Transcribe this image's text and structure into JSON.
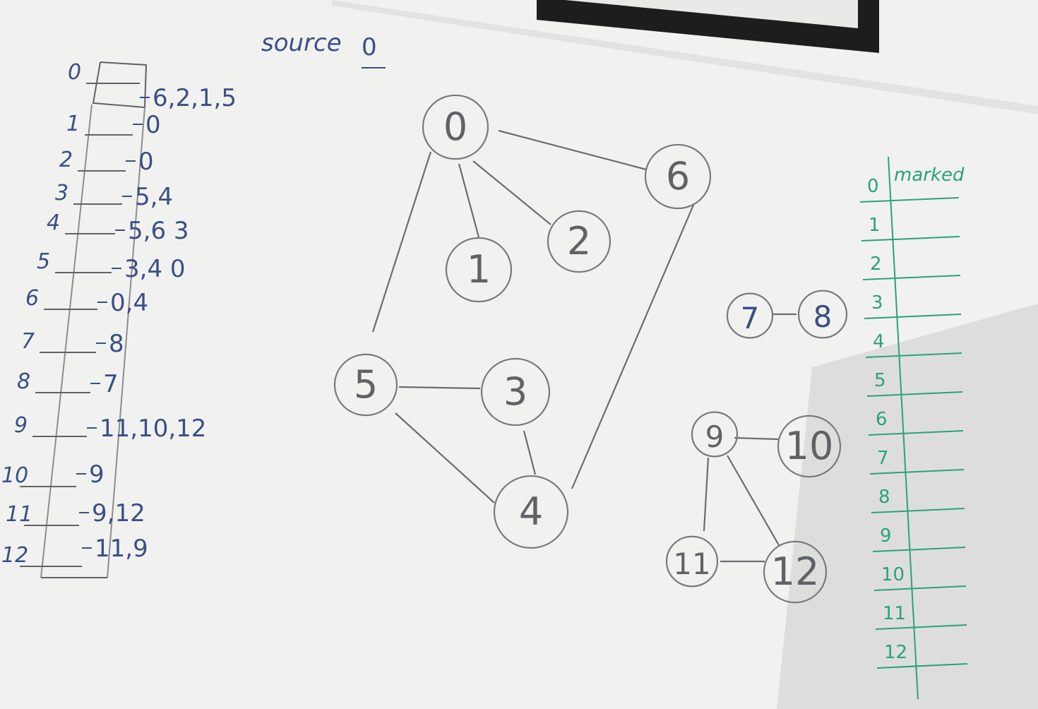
{
  "board": {
    "source_label": "source",
    "source_value": "0",
    "marked_header": "marked",
    "colors": {
      "wall": "#d6d4cf",
      "board": "#f3f4f2",
      "ink_blue": "#3b4f86",
      "ink_grey": "#5f6266",
      "ink_green": "#2aa27a",
      "frame": "#1d1d1d"
    }
  },
  "adjacency_list": [
    {
      "index": "0",
      "neighbors": "6,2,1,5"
    },
    {
      "index": "1",
      "neighbors": "0"
    },
    {
      "index": "2",
      "neighbors": "0"
    },
    {
      "index": "3",
      "neighbors": "5,4"
    },
    {
      "index": "4",
      "neighbors": "5,6 3"
    },
    {
      "index": "5",
      "neighbors": "3,4 0"
    },
    {
      "index": "6",
      "neighbors": "0,4"
    },
    {
      "index": "7",
      "neighbors": "8"
    },
    {
      "index": "8",
      "neighbors": "7"
    },
    {
      "index": "9",
      "neighbors": "11,10,12"
    },
    {
      "index": "10",
      "neighbors": "9"
    },
    {
      "index": "11",
      "neighbors": "9,12"
    },
    {
      "index": "12",
      "neighbors": "11,9"
    }
  ],
  "graph": {
    "nodes": [
      "0",
      "1",
      "2",
      "3",
      "4",
      "5",
      "6",
      "7",
      "8",
      "9",
      "10",
      "11",
      "12"
    ],
    "edges": [
      [
        "0",
        "6"
      ],
      [
        "0",
        "2"
      ],
      [
        "0",
        "1"
      ],
      [
        "0",
        "5"
      ],
      [
        "5",
        "3"
      ],
      [
        "5",
        "4"
      ],
      [
        "3",
        "4"
      ],
      [
        "6",
        "4"
      ],
      [
        "7",
        "8"
      ],
      [
        "9",
        "10"
      ],
      [
        "9",
        "11"
      ],
      [
        "9",
        "12"
      ],
      [
        "11",
        "12"
      ]
    ]
  },
  "marked_rows": [
    "0",
    "1",
    "2",
    "3",
    "4",
    "5",
    "6",
    "7",
    "8",
    "9",
    "10",
    "11",
    "12"
  ]
}
